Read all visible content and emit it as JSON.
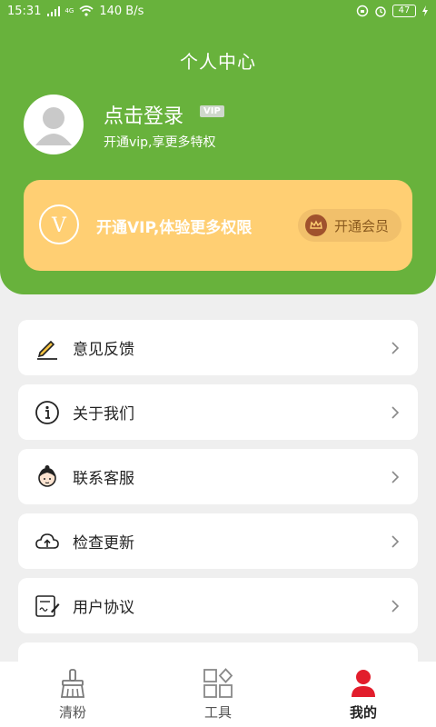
{
  "status_bar": {
    "time": "15:31",
    "network_label": "4G",
    "speed": "140 B/s",
    "battery": "47"
  },
  "header": {
    "title": "个人中心",
    "login_title": "点击登录",
    "vip_tag": "VIP",
    "login_subtitle": "开通vip,享更多特权"
  },
  "vip_card": {
    "badge_letter": "V",
    "text": "开通VIP,体验更多权限",
    "button_label": "开通会员"
  },
  "menu": {
    "items": [
      {
        "label": "意见反馈",
        "icon": "pencil-icon"
      },
      {
        "label": "关于我们",
        "icon": "info-icon"
      },
      {
        "label": "联系客服",
        "icon": "customer-service-icon"
      },
      {
        "label": "检查更新",
        "icon": "cloud-upload-icon"
      },
      {
        "label": "用户协议",
        "icon": "document-sign-icon"
      }
    ]
  },
  "bottom_nav": {
    "tabs": [
      {
        "label": "清粉",
        "icon": "broom-icon",
        "active": false
      },
      {
        "label": "工具",
        "icon": "grid-icon",
        "active": false
      },
      {
        "label": "我的",
        "icon": "user-icon",
        "active": true
      }
    ]
  },
  "colors": {
    "header_green": "#68b23c",
    "vip_card_yellow": "#ffcf73",
    "active_nav_red": "#e21d2c"
  }
}
